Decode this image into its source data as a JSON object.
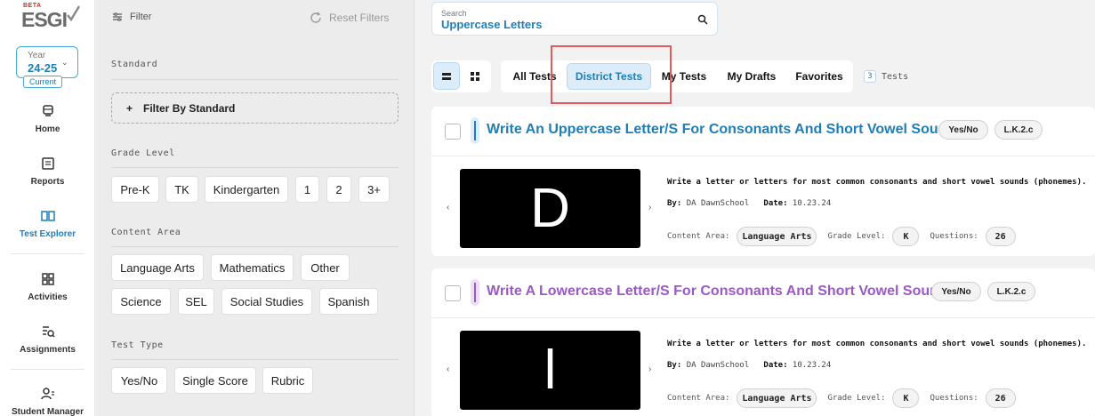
{
  "logo": {
    "beta": "BETA",
    "name": "ESGI"
  },
  "year": {
    "label": "Year",
    "value": "24-25",
    "current": "Current"
  },
  "nav": [
    {
      "label": "Home",
      "icon": "home-icon"
    },
    {
      "label": "Reports",
      "icon": "reports-icon"
    },
    {
      "label": "Test Explorer",
      "icon": "book-icon"
    },
    {
      "label": "Activities",
      "icon": "grid-icon"
    },
    {
      "label": "Assignments",
      "icon": "list-search-icon"
    },
    {
      "label": "Student Manager",
      "icon": "users-icon"
    }
  ],
  "filter": {
    "title": "Filter",
    "reset": "Reset Filters",
    "standard_title": "Standard",
    "filter_by_standard": "Filter By Standard",
    "grade_title": "Grade Level",
    "grades": [
      "Pre-K",
      "TK",
      "Kindergarten",
      "1",
      "2",
      "3+"
    ],
    "content_title": "Content Area",
    "content": [
      "Language Arts",
      "Mathematics",
      "Other",
      "Science",
      "SEL",
      "Social Studies",
      "Spanish"
    ],
    "type_title": "Test Type",
    "types": [
      "Yes/No",
      "Single Score",
      "Rubric"
    ]
  },
  "search": {
    "placeholder": "Search",
    "value": "Uppercase Letters"
  },
  "tabs": [
    "All Tests",
    "District Tests",
    "My Tests",
    "My Drafts",
    "Favorites"
  ],
  "count": {
    "number": "3",
    "label": "Tests"
  },
  "cards": [
    {
      "title": "Write An Uppercase Letter/S For Consonants And Short Vowel Sounds",
      "title_color": "#1e7eb8",
      "type": "Yes/No",
      "standard": "L.K.2.c",
      "letter": "D",
      "description": "Write a letter or letters for most common consonants and short vowel sounds (phonemes).",
      "by_label": "By:",
      "author": "DA DawnSchool",
      "date_label": "Date:",
      "date": "10.23.24",
      "content_label": "Content Area:",
      "content": "Language Arts",
      "grade_label": "Grade Level:",
      "grade": "K",
      "questions_label": "Questions:",
      "questions": "26"
    },
    {
      "title": "Write A Lowercase Letter/S For Consonants And Short Vowel Sounds",
      "title_color": "#9b59c6",
      "type": "Yes/No",
      "standard": "L.K.2.c",
      "letter": "l",
      "description": "Write a letter or letters for most common consonants and short vowel sounds (phonemes).",
      "by_label": "By:",
      "author": "DA DawnSchool",
      "date_label": "Date:",
      "date": "10.23.24",
      "content_label": "Content Area:",
      "content": "Language Arts",
      "grade_label": "Grade Level:",
      "grade": "K",
      "questions_label": "Questions:",
      "questions": "26"
    }
  ]
}
